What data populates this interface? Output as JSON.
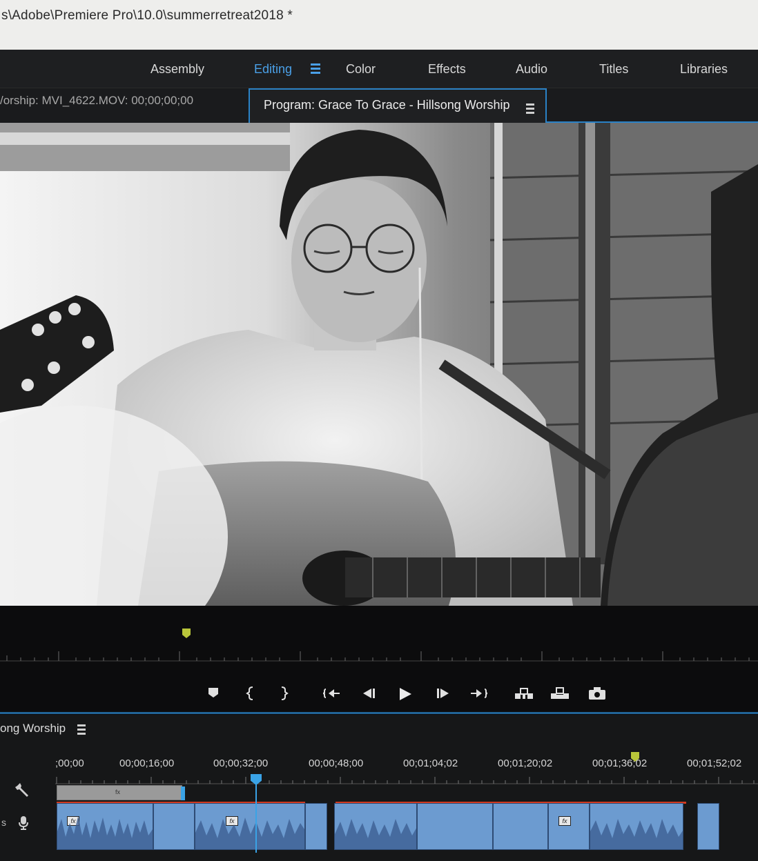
{
  "app": {
    "path": "s\\Adobe\\Premiere Pro\\10.0\\summerretreat2018 *"
  },
  "workspaces": [
    {
      "label": "Assembly",
      "active": false
    },
    {
      "label": "Editing",
      "active": true
    },
    {
      "label": "Color",
      "active": false
    },
    {
      "label": "Effects",
      "active": false
    },
    {
      "label": "Audio",
      "active": false
    },
    {
      "label": "Titles",
      "active": false
    },
    {
      "label": "Libraries",
      "active": false
    }
  ],
  "panels": {
    "source_tab": "/orship: MVI_4622.MOV: 00;00;00;00",
    "program_tab": "Program: Grace To Grace - Hillsong Worship"
  },
  "program_monitor": {
    "controls": [
      "add-marker",
      "mark-in",
      "mark-out",
      "go-to-in",
      "step-back",
      "play",
      "step-forward",
      "go-to-out",
      "lift",
      "extract",
      "export-frame"
    ]
  },
  "timeline": {
    "sequence_title": "ong Worship",
    "timecodes": [
      ";00;00",
      "00;00;16;00",
      "00;00;32;00",
      "00;00;48;00",
      "00;01;04;02",
      "00;01;20;02",
      "00;01;36;02",
      "00;01;52;02"
    ],
    "track_label": "s"
  },
  "colors": {
    "accent": "#2a82c7",
    "playhead": "#3aa3e6",
    "marker": "#b9c63a",
    "audio_clip": "#6c9bd0",
    "render_bar": "#d23a20"
  }
}
